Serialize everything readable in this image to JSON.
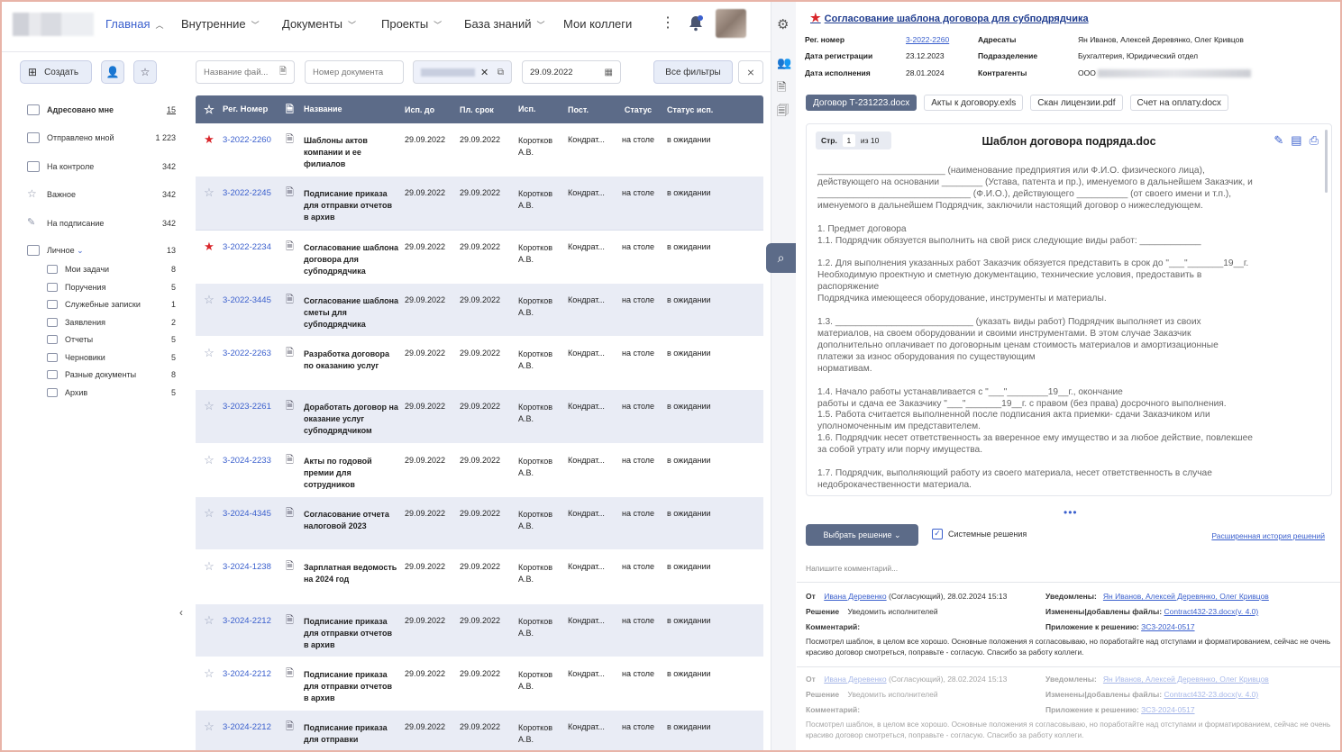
{
  "nav": {
    "items": [
      {
        "label": "Главная",
        "active": true
      },
      {
        "label": "Внутренние"
      },
      {
        "label": "Документы"
      },
      {
        "label": "Проекты"
      },
      {
        "label": "База знаний"
      },
      {
        "label": "Мои коллеги"
      }
    ],
    "more": "⋮"
  },
  "toolbar": {
    "create_label": "Создать"
  },
  "filters": {
    "filename_placeholder": "Название фай...",
    "docnum_placeholder": "Номер документа",
    "date_value": "29.09.2022",
    "all_filters_label": "Все фильтры"
  },
  "sidebar": {
    "items": [
      {
        "label": "Адресовано мне",
        "count": "15"
      },
      {
        "label": "Отправлено мной",
        "count": "1 223"
      },
      {
        "label": "На контроле",
        "count": "342"
      },
      {
        "label": "Важное",
        "count": "342"
      },
      {
        "label": "На подписание",
        "count": "342"
      },
      {
        "label": "Личное",
        "count": "13"
      }
    ],
    "sub": [
      {
        "label": "Мои задачи",
        "count": "8"
      },
      {
        "label": "Поручения",
        "count": "5"
      },
      {
        "label": "Служебные записки",
        "count": "1"
      },
      {
        "label": "Заявления",
        "count": "2"
      },
      {
        "label": "Отчеты",
        "count": "5"
      },
      {
        "label": "Черновики",
        "count": "5"
      },
      {
        "label": "Разные документы",
        "count": "8"
      },
      {
        "label": "Архив",
        "count": "5"
      }
    ]
  },
  "table": {
    "headers": [
      "Рег. Номер",
      "Название",
      "Исп. до",
      "Пл. срок",
      "Исп.",
      "Пост.",
      "Статус",
      "Статус исп."
    ],
    "rows": [
      {
        "starred": true,
        "reg": "3-2022-2260",
        "name": "Шаблоны актов компании и ее филиалов",
        "d1": "29.09.2022",
        "d2": "29.09.2022",
        "isp": "Коротков А.В.",
        "post": "Кондрат...",
        "status": "на столе",
        "status_isp": "в ожидании"
      },
      {
        "starred": false,
        "reg": "3-2022-2245",
        "name": "Подписание приказа для отправки отчетов в архив",
        "d1": "29.09.2022",
        "d2": "29.09.2022",
        "isp": "Коротков А.В.",
        "post": "Кондрат...",
        "status": "на столе",
        "status_isp": "в ожидании"
      },
      {
        "starred": true,
        "reg": "3-2022-2234",
        "name": "Согласование шаблона договора для субподрядчика",
        "d1": "29.09.2022",
        "d2": "29.09.2022",
        "isp": "Коротков А.В.",
        "post": "Кондрат...",
        "status": "на столе",
        "status_isp": "в ожидании"
      },
      {
        "starred": false,
        "reg": "3-2022-3445",
        "name": "Согласование шаблона сметы для субподрядчика",
        "d1": "29.09.2022",
        "d2": "29.09.2022",
        "isp": "Коротков А.В.",
        "post": "Кондрат...",
        "status": "на столе",
        "status_isp": "в ожидании"
      },
      {
        "starred": false,
        "reg": "3-2022-2263",
        "name": "Разработка договора по оказанию услуг",
        "d1": "29.09.2022",
        "d2": "29.09.2022",
        "isp": "Коротков А.В.",
        "post": "Кондрат...",
        "status": "на столе",
        "status_isp": "в ожидании"
      },
      {
        "starred": false,
        "reg": "3-2023-2261",
        "name": "Доработать договор на оказание услуг субподрядчиком",
        "d1": "29.09.2022",
        "d2": "29.09.2022",
        "isp": "Коротков А.В.",
        "post": "Кондрат...",
        "status": "на столе",
        "status_isp": "в ожидании"
      },
      {
        "starred": false,
        "reg": "3-2024-2233",
        "name": "Акты по годовой премии для сотрудников",
        "d1": "29.09.2022",
        "d2": "29.09.2022",
        "isp": "Коротков А.В.",
        "post": "Кондрат...",
        "status": "на столе",
        "status_isp": "в ожидании"
      },
      {
        "starred": false,
        "reg": "3-2024-4345",
        "name": "Согласование отчета налоговой 2023",
        "d1": "29.09.2022",
        "d2": "29.09.2022",
        "isp": "Коротков А.В.",
        "post": "Кондрат...",
        "status": "на столе",
        "status_isp": "в ожидании"
      },
      {
        "starred": false,
        "reg": "3-2024-1238",
        "name": "Зарплатная ведомость на 2024 год",
        "d1": "29.09.2022",
        "d2": "29.09.2022",
        "isp": "Коротков А.В.",
        "post": "Кондрат...",
        "status": "на столе",
        "status_isp": "в ожидании"
      },
      {
        "starred": false,
        "reg": "3-2024-2212",
        "name": "Подписание приказа для отправки отчетов в архив",
        "d1": "29.09.2022",
        "d2": "29.09.2022",
        "isp": "Коротков А.В.",
        "post": "Кондрат...",
        "status": "на столе",
        "status_isp": "в ожидании"
      },
      {
        "starred": false,
        "reg": "3-2024-2212",
        "name": "Подписание приказа для отправки отчетов в архив",
        "d1": "29.09.2022",
        "d2": "29.09.2022",
        "isp": "Коротков А.В.",
        "post": "Кондрат...",
        "status": "на столе",
        "status_isp": "в ожидании"
      },
      {
        "starred": false,
        "reg": "3-2024-2212",
        "name": "Подписание приказа для отправки",
        "d1": "29.09.2022",
        "d2": "29.09.2022",
        "isp": "Коротков А.В.",
        "post": "Кондрат...",
        "status": "на столе",
        "status_isp": "в ожидании"
      }
    ]
  },
  "detail": {
    "title": "Согласование шаблона договора для субподрядчика",
    "meta": {
      "reg_label": "Рег. номер",
      "reg_value": "3-2022-2260",
      "regdate_label": "Дата регистрации",
      "regdate_value": "23.12.2023",
      "execdate_label": "Дата исполнения",
      "execdate_value": "28.01.2024",
      "addressees_label": "Адресаты",
      "addressees_value": "Ян Иванов, Алексей Деревянко, Олег Кривцов",
      "units_label": "Подразделение",
      "units_value": "Бухгалтерия, Юридический отдел",
      "contractors_label": "Контрагенты",
      "contractors_value": "ООО"
    },
    "files": [
      "Договор Т-231223.docx",
      "Акты к договору.exls",
      "Скан лицензии.pdf",
      "Счет на оплату.docx"
    ],
    "pager": {
      "label": "Стр.",
      "page": "1",
      "of": "из 10"
    },
    "doc_title": "Шаблон договора подряда.doc",
    "doc_lines": [
      "_________________________ (наименование предприятия или Ф.И.О. физического лица),",
      "действующего на основании ________ (Устава, патента и пр.), именуемого в дальнейшем Заказчик, и",
      "______________________________ (Ф.И.О.), действующего __________ (от своего имени и т.п.),",
      "именуемого в дальнейшем Подрядчик, заключили настоящий договор о нижеследующем.",
      "",
      "    1. Предмет договора",
      "1.1. Подрядчик обязуется выполнить на свой риск следующие виды работ: ____________",
      "",
      "1.2. Для выполнения указанных работ Заказчик обязуется представить в срок до \"___\"_______19__г.",
      "Необходимую проектную и сметную документацию, технические условия, предоставить в",
      "распоряжение",
      "Подрядчика имеющееся оборудование, инструменты и материалы.",
      "",
      "1.3. ___________________________ (указать виды работ) Подрядчик выполняет из своих",
      "материалов, на своем оборудовании и своими инструментами. В этом случае Заказчик",
      "дополнительно оплачивает по договорным ценам стоимость материалов и амортизационные",
      "платежи за износ оборудования по существующим",
      "нормативам.",
      "",
      "1.4. Начало работы устанавливается с \"___\"________19__г., окончание",
      "работы и сдача ее Заказчику \"___\"_______19__г. с правом (без права) досрочного выполнения.",
      "1.5. Работа считается выполненной после подписания акта приемки- сдачи Заказчиком или",
      "уполномоченным им представителем.",
      "1.6. Подрядчик несет ответственность за вверенное ему имущество и за любое действие, повлекшее",
      "за собой утрату или порчу имущества.",
      "",
      "1.7. Подрядчик, выполняющий работу из своего материала, несет ответственность в случае",
      "недоброкачественности материала."
    ],
    "decision_btn": "Выбрать решение",
    "system_decisions": "Системные решения",
    "history_link": "Расширенная история решений",
    "comment_placeholder": "Напишите комментарий...",
    "history": [
      {
        "from_label": "От",
        "from_name": "Ивана Деревенко",
        "from_rest": "(Согласующий), 28.02.2024 15:13",
        "decision_label": "Решение",
        "decision_value": "Уведомить исполнителей",
        "comment_label": "Комментарий:",
        "notified_label": "Уведомлены:",
        "notified_value": "Ян Иванов, Алексей Деревянко, Олег Кривцов",
        "files_label": "Изменены|добавлены файлы:",
        "files_value": "Contract432-23.docx(v. 4.0)",
        "attach_label": "Приложение к решению:",
        "attach_value": "ЗС3-2024-0517",
        "text": "Посмотрел шаблон, в целом все хорошо. Основные положения я согласовываю, но поработайте над отступами и форматированием, сейчас не очень красиво договор смотреться, поправьте - согласую. Спасибо за работу коллеги."
      },
      {
        "from_label": "От",
        "from_name": "Ивана Деревенко",
        "from_rest": "(Согласующий), 28.02.2024 15:13",
        "decision_label": "Решение",
        "decision_value": "Уведомить исполнителей",
        "comment_label": "Комментарий:",
        "notified_label": "Уведомлены:",
        "notified_value": "Ян Иванов, Алексей Деревянко, Олег Кривцов",
        "files_label": "Изменены|добавлены файлы:",
        "files_value": "Contract432-23.docx(v. 4.0)",
        "attach_label": "Приложение к решению:",
        "attach_value": "ЗС3-2024-0517",
        "text": "Посмотрел шаблон, в целом все хорошо. Основные положения я согласовываю, но поработайте над отступами и форматированием, сейчас не очень красиво договор смотреться, поправьте - согласую. Спасибо за работу коллеги."
      }
    ]
  },
  "colors": {
    "accent": "#3a5fcd",
    "header": "#5c6b88",
    "star": "#d9262b"
  }
}
